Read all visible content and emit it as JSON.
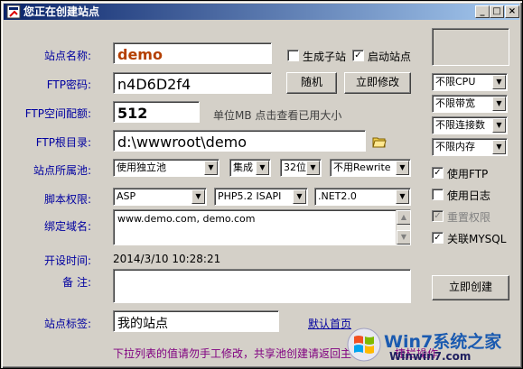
{
  "window": {
    "title": "您正在创建站点",
    "controls": [
      "_",
      "□",
      "×"
    ]
  },
  "fields": {
    "site_name": {
      "label": "站点名称:",
      "value": "demo"
    },
    "ftp_password": {
      "label": "FTP密码:",
      "value": "n4D6D2f4"
    },
    "ftp_quota": {
      "label": "FTP空间配额:",
      "value": "512",
      "hint": "单位MB 点击查看已用大小"
    },
    "ftp_root": {
      "label": "FTP根目录:",
      "value": "d:\\wwwroot\\demo"
    },
    "app_pool": {
      "label": "站点所属池:",
      "pool": "使用独立池",
      "mode": "集成",
      "bits": "32位",
      "rewrite": "不用Rewrite"
    },
    "script": {
      "label": "脚本权限:",
      "asp": "ASP",
      "php": "PHP5.2 ISAPI",
      "net": ".NET2.0"
    },
    "domains": {
      "label": "绑定域名:",
      "value": "www.demo.com, demo.com"
    },
    "open_time": {
      "label": "开设时间:",
      "value": "2014/3/10 10:28:21"
    },
    "remark": {
      "label": "备 注:",
      "value": ""
    },
    "site_tag": {
      "label": "站点标签:",
      "value": "我的站点",
      "link": "默认首页"
    }
  },
  "buttons": {
    "random": "随机",
    "modify": "立即修改",
    "create": "立即创建"
  },
  "checks": {
    "sub_site": {
      "label": "生成子站",
      "checked": false
    },
    "start_site": {
      "label": "启动站点",
      "checked": true
    },
    "use_ftp": {
      "label": "使用FTP",
      "checked": true
    },
    "use_log": {
      "label": "使用日志",
      "checked": false
    },
    "reset_perm": {
      "label": "重置权限",
      "checked": true,
      "disabled": true
    },
    "mysql": {
      "label": "关联MYSQL",
      "checked": true
    }
  },
  "limits": {
    "cpu": "不限CPU",
    "bandwidth": "不限带宽",
    "connections": "不限连接数",
    "memory": "不限内存"
  },
  "footer_note": "下拉列表的值请勿手工修改，共享池创建请返回主",
  "footer_note_tail": "捷栏操作",
  "watermark": {
    "brand": "Win7系统之家",
    "url": "Winwin7.com"
  },
  "icons": {
    "app": "app-icon",
    "folder": "folder-icon",
    "dropdown": "chevron-down-icon"
  }
}
